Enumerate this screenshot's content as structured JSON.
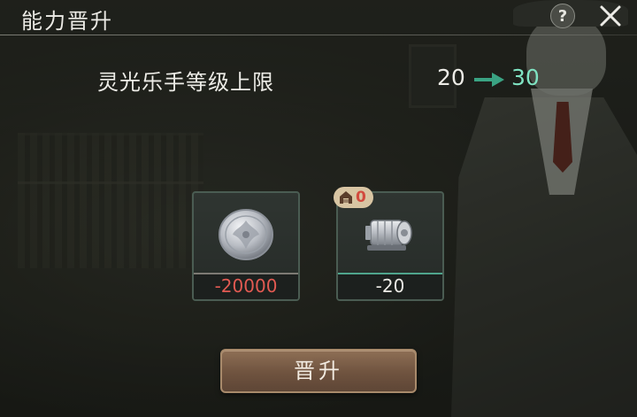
{
  "header": {
    "title": "能力晋升",
    "help_label": "?"
  },
  "level": {
    "label": "灵光乐手等级上限",
    "from": "20",
    "to": "30"
  },
  "costs": [
    {
      "item_icon": "silver-coin-icon",
      "amount": "-20000",
      "color": "#e25a52"
    },
    {
      "item_icon": "machine-part-icon",
      "amount": "-20",
      "color": "#ecebe6",
      "stock": "0"
    }
  ],
  "actions": {
    "upgrade_label": "晋升"
  },
  "colors": {
    "accent_green": "#7fe3c2",
    "cost_red": "#e25a52",
    "button_brown": "#6f533f"
  }
}
